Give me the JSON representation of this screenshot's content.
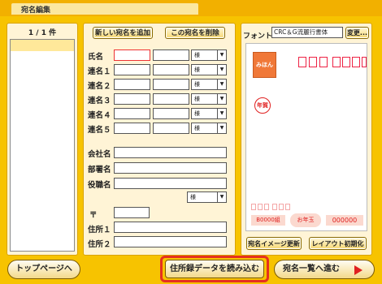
{
  "window": {
    "title": "宛名編集"
  },
  "list_panel": {
    "counter": "1 / 1 件"
  },
  "address_form": {
    "add_button": "新しい宛名を追加",
    "delete_button": "この宛名を削除",
    "fields": {
      "name": "氏名",
      "joint1": "連名１",
      "joint2": "連名２",
      "joint3": "連名３",
      "joint4": "連名４",
      "joint5": "連名５",
      "company": "会社名",
      "department": "部署名",
      "position": "役職名",
      "postal": "〒",
      "address1": "住所１",
      "address2": "住所２"
    },
    "honorific": "様"
  },
  "preview": {
    "font_label": "フォント",
    "font_value": "CRC＆G流麗行書体",
    "change_button": "変更...",
    "stamp_text": "みほん",
    "nenga_mark": "年賀",
    "lottery_number": "B0000組",
    "lottery_text": "お年玉",
    "prize_number": "000000",
    "update_button": "宛名イメージ更新",
    "reset_button": "レイアウト初期化"
  },
  "footer": {
    "top_page_button": "トップページへ",
    "import_button": "住所録データを読み込む",
    "next_button": "宛名一覧へ進む"
  },
  "colors": {
    "background": "#f7c300",
    "accent_red": "#e02020"
  }
}
